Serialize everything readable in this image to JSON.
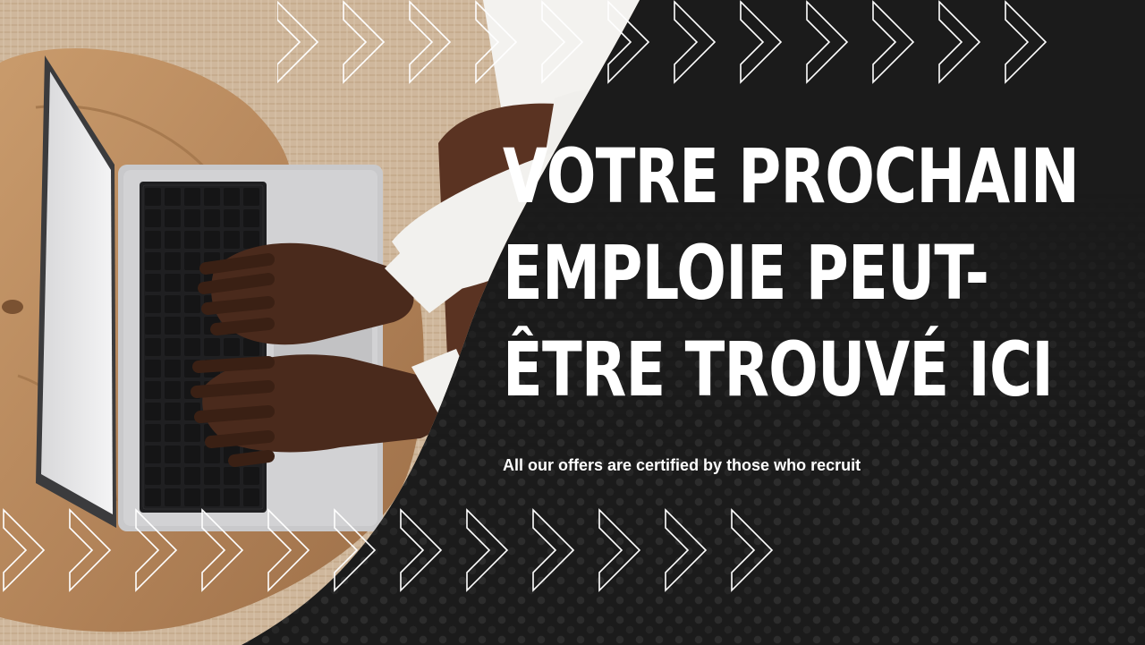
{
  "banner": {
    "headline_lines": [
      "VOTRE PROCHAIN",
      "EMPLOIE PEUT-",
      "ÊTRE TROUVÉ ICI"
    ],
    "subtitle": "All our offers are certified by those who recruit"
  },
  "colors": {
    "background": "#1b1b1b",
    "text": "#ffffff",
    "chevron_stroke": "#ffffff",
    "rug": "#cdb59a",
    "table_wood": "#b98a5f",
    "laptop": "#c9c9cb",
    "skin": "#4a2a1c",
    "sweater": "#f2f1ee"
  },
  "icons": {
    "top_chevrons": "chevron-right-outline-icon",
    "bottom_chevrons": "chevron-right-outline-icon"
  }
}
